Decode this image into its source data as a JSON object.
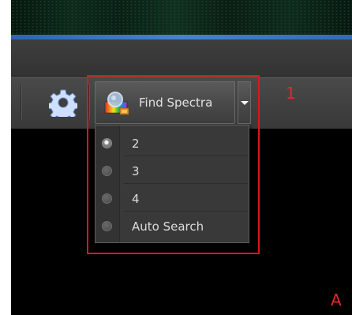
{
  "toolbar": {
    "find_spectra_label": "Find Spectra"
  },
  "menu": {
    "items": [
      {
        "label": "2",
        "selected": true
      },
      {
        "label": "3",
        "selected": false
      },
      {
        "label": "4",
        "selected": false
      },
      {
        "label": "Auto Search",
        "selected": false
      }
    ]
  },
  "annotations": {
    "callout_1": "1",
    "callout_a": "A"
  },
  "colors": {
    "annotation_red": "#e0151b",
    "accent_blue": "#3568bd",
    "background": "#000000"
  },
  "icons": {
    "settings": "gear-icon",
    "find_spectra": "find-spectra-icon",
    "dropdown": "dropdown-arrow-icon"
  }
}
